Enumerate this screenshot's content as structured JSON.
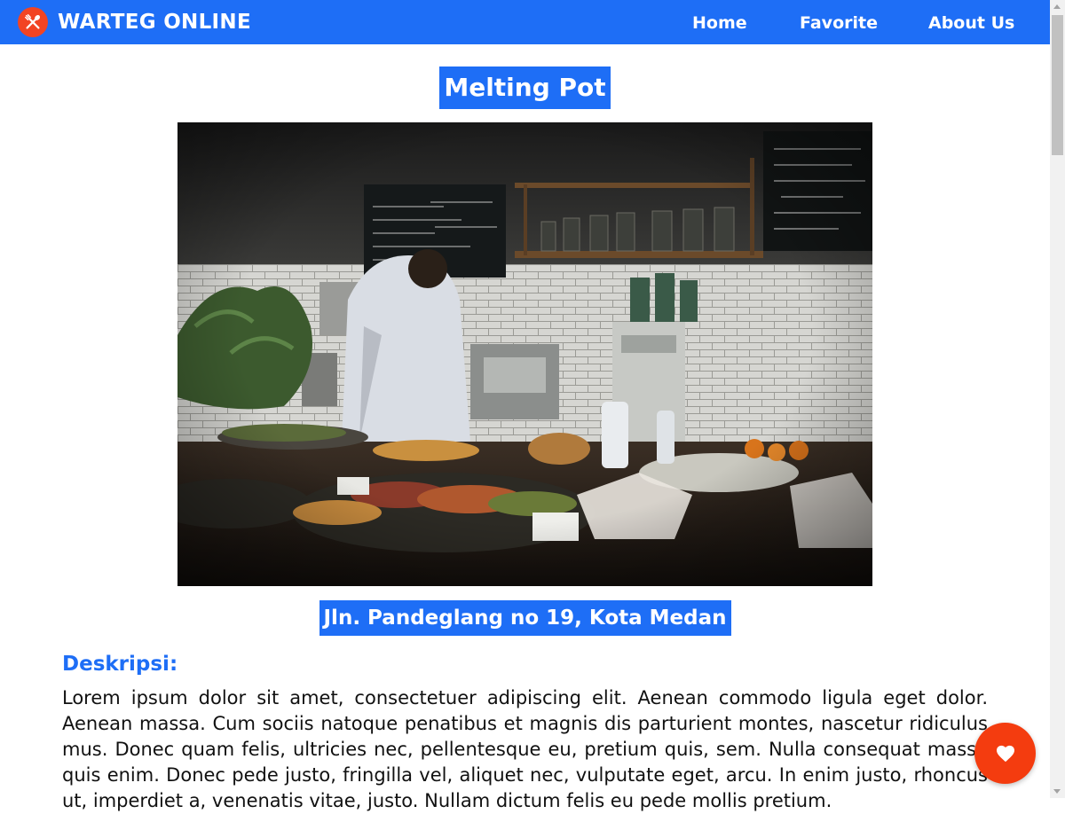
{
  "header": {
    "brand_name": "WARTEG ONLINE",
    "logo_icon": "utensils-icon",
    "nav": [
      {
        "label": "Home"
      },
      {
        "label": "Favorite"
      },
      {
        "label": "About Us"
      }
    ]
  },
  "restaurant": {
    "name": "Melting Pot",
    "image_icon": "restaurant-photo",
    "address": "Jln. Pandeglang no 19, Kota Medan",
    "description_heading": "Deskripsi:",
    "description": "Lorem ipsum dolor sit amet, consectetuer adipiscing elit. Aenean commodo ligula eget dolor. Aenean massa. Cum sociis natoque penatibus et magnis dis parturient montes, nascetur ridiculus mus. Donec quam felis, ultricies nec, pellentesque eu, pretium quis, sem. Nulla consequat massa quis enim. Donec pede justo, fringilla vel, aliquet nec, vulputate eget, arcu. In enim justo, rhoncus ut, imperdiet a, venenatis vitae, justo. Nullam dictum felis eu pede mollis pretium."
  },
  "fab": {
    "icon": "heart-icon"
  },
  "colors": {
    "primary": "#1e6ef6",
    "accent": "#f24423",
    "favorite": "#f43c0f"
  }
}
